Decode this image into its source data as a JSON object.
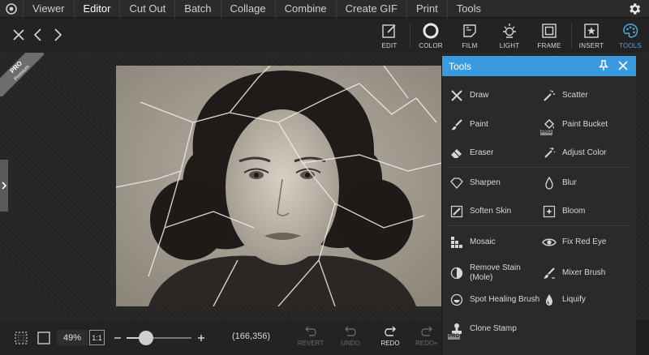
{
  "menu": {
    "items": [
      "Viewer",
      "Editor",
      "Cut Out",
      "Batch",
      "Collage",
      "Combine",
      "Create GIF",
      "Print",
      "Tools"
    ],
    "active": "Editor"
  },
  "toolbar": {
    "tabs": [
      {
        "label": "EDIT",
        "icon": "edit-icon"
      },
      {
        "label": "COLOR",
        "icon": "color-icon"
      },
      {
        "label": "FILM",
        "icon": "film-icon"
      },
      {
        "label": "LIGHT",
        "icon": "light-icon"
      },
      {
        "label": "FRAME",
        "icon": "frame-icon"
      },
      {
        "label": "INSERT",
        "icon": "insert-icon"
      },
      {
        "label": "TOOLS",
        "icon": "tools-icon"
      }
    ],
    "active_tab": "TOOLS",
    "accent_color": "#4aa8e6"
  },
  "canvas": {
    "pro_badge": "PRO",
    "pro_badge_sub": "Premium"
  },
  "tools_panel": {
    "title": "Tools",
    "header_color": "#3a9ae0",
    "tools": [
      {
        "label": "Draw",
        "icon": "draw-icon"
      },
      {
        "label": "Scatter",
        "icon": "scatter-icon"
      },
      {
        "label": "Paint",
        "icon": "paint-brush-icon"
      },
      {
        "label": "Paint Bucket",
        "icon": "paint-bucket-icon",
        "pro": "PRO"
      },
      {
        "label": "Eraser",
        "icon": "eraser-icon"
      },
      {
        "label": "Adjust Color",
        "icon": "adjust-color-icon"
      },
      {
        "label": "Sharpen",
        "icon": "sharpen-icon"
      },
      {
        "label": "Blur",
        "icon": "blur-icon"
      },
      {
        "label": "Soften Skin",
        "icon": "soften-skin-icon"
      },
      {
        "label": "Bloom",
        "icon": "bloom-icon"
      },
      {
        "label": "Mosaic",
        "icon": "mosaic-icon"
      },
      {
        "label": "Fix Red Eye",
        "icon": "eye-icon"
      },
      {
        "label": "Remove Stain\n(Mole)",
        "icon": "remove-stain-icon"
      },
      {
        "label": "Mixer Brush",
        "icon": "mixer-brush-icon"
      },
      {
        "label": "Spot Healing Brush",
        "icon": "spot-healing-icon"
      },
      {
        "label": "Liquify",
        "icon": "liquify-icon"
      },
      {
        "label": "Clone Stamp",
        "icon": "clone-stamp-icon",
        "pro": "PRO"
      }
    ]
  },
  "bottom": {
    "zoom": "49%",
    "ratio": "1:1",
    "zoom_level": 0.3,
    "coords": "(166,356)",
    "history": [
      {
        "label": "REVERT",
        "enabled": false
      },
      {
        "label": "UNDO",
        "enabled": false
      },
      {
        "label": "REDO",
        "enabled": true
      },
      {
        "label": "REDO+",
        "enabled": false
      }
    ]
  }
}
